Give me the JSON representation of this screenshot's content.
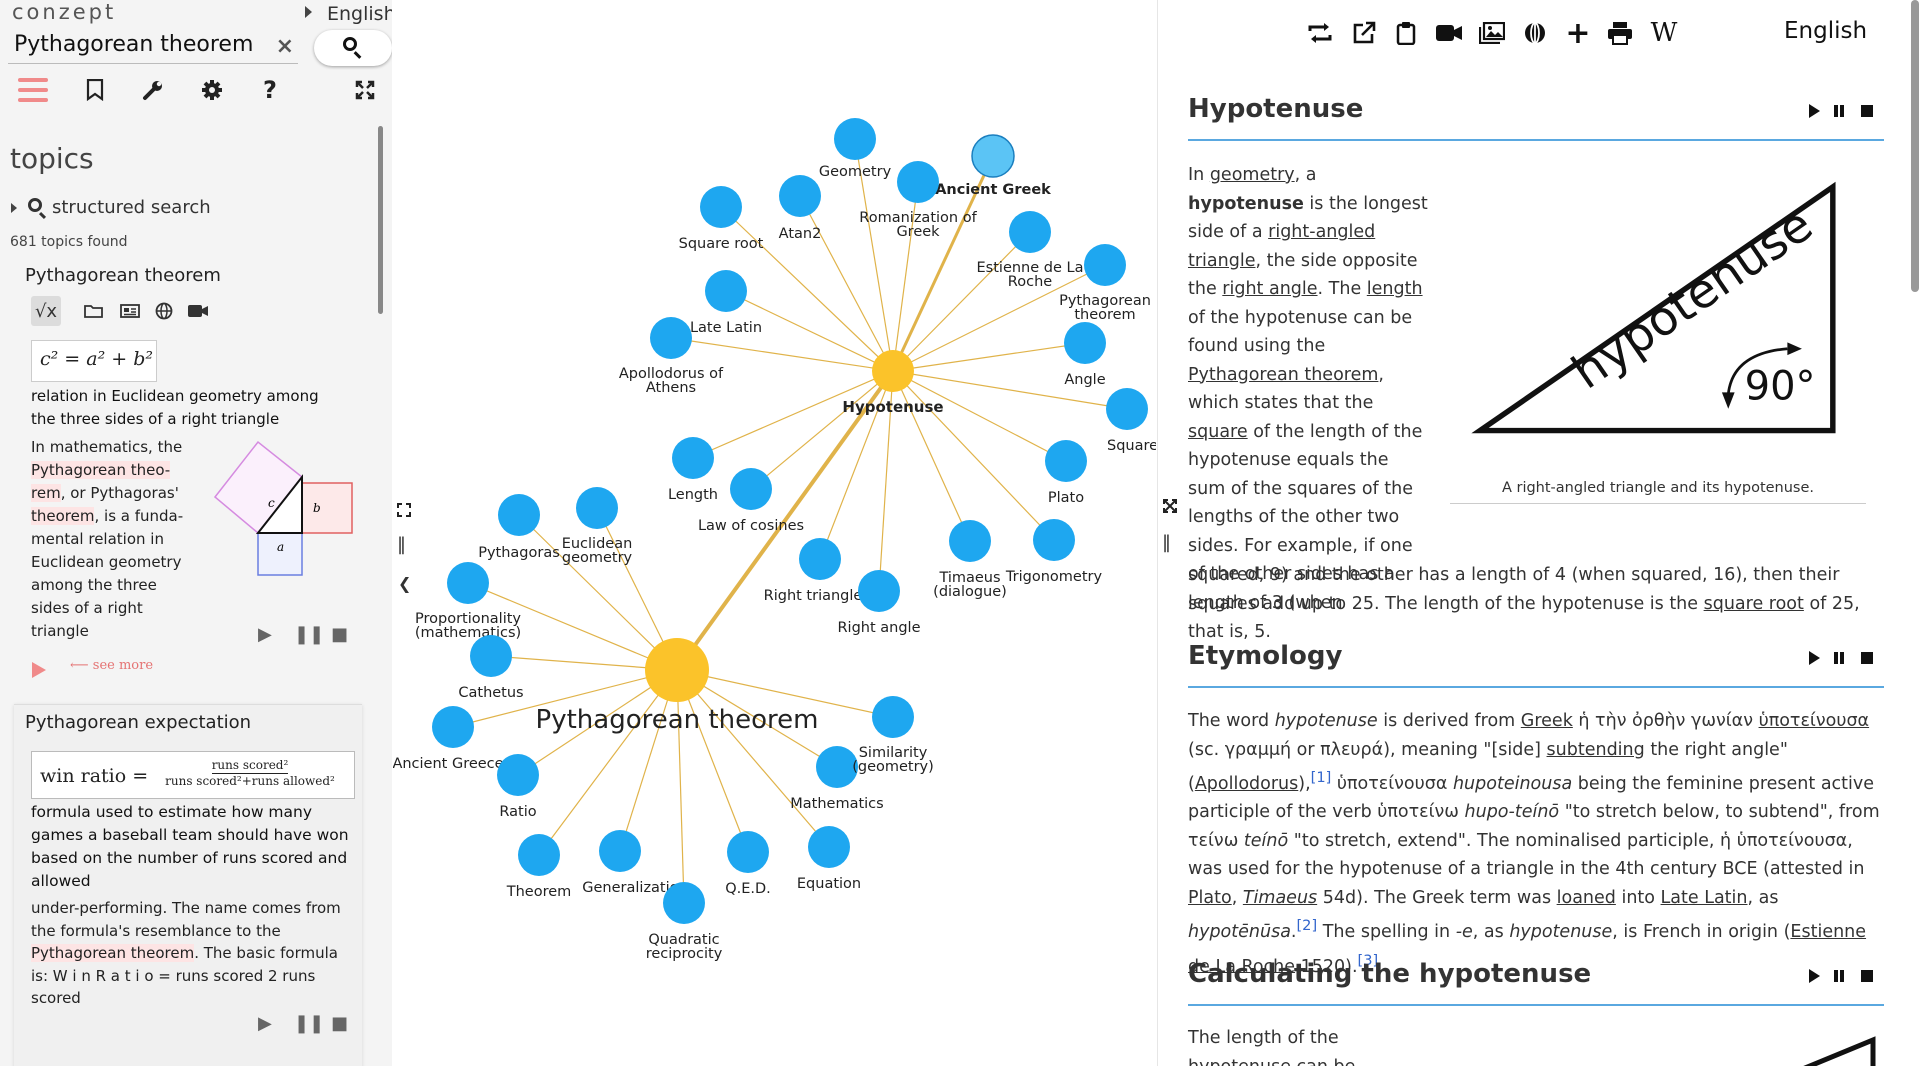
{
  "app": {
    "brand": "conzept",
    "language": "English"
  },
  "search": {
    "value": "Pythagorean theorem",
    "clear_icon": "×"
  },
  "toolbar": {
    "icons": [
      "hamburger-icon",
      "bookmark-icon",
      "wrench-icon",
      "gear-icon",
      "help-icon",
      "fullscreen-icon"
    ]
  },
  "topics": {
    "heading": "topics",
    "structured_search": "structured search",
    "found": "681 topics found"
  },
  "card1": {
    "title": "Pythagorean theorem",
    "formula": "c² = a² + b²",
    "description": "relation in Euclidean geometry among the three sides of a right triangle",
    "summary_pre": "In mathematics, the ",
    "summary_hl1": "Pythagorean theo-rem",
    "summary_mid": ", or Pythagoras' ",
    "summary_hl2": "theorem",
    "summary_post": ", is a funda-mental relation in Euclidean geometry among the three sides of a right triangle",
    "fig_labels": {
      "c": "c",
      "b": "b",
      "a": "a"
    },
    "see_more": "⟵ see more"
  },
  "card2": {
    "title": "Pythagorean expectation",
    "formula_lhs": "win ratio =",
    "formula_num": "runs scored²",
    "formula_den": "runs scored²+runs allowed²",
    "description": "formula used to estimate how many games a baseball team should have won based on the number of runs scored and allowed",
    "summary_pre": "under-performing. The name comes from the formula's resemblance to the ",
    "summary_hl": "Pythagorean theorem",
    "summary_post": ". The basic formula is: W i n   R a t i o = runs scored 2 runs scored"
  },
  "graph": {
    "center_label": "Pythagorean theorem",
    "hub_label": "Hypotenuse",
    "nodes_hub": [
      "Geometry",
      "Ancient Greek",
      "Square root",
      "Atan2",
      "Romanization of Greek",
      "Estienne de La Roche",
      "Pythagorean theorem",
      "Late Latin",
      "Apollodorus of Athens",
      "Angle",
      "Square (algebra)",
      "Plato",
      "Length",
      "Law of cosines",
      "Right triangle",
      "Right angle",
      "Timaeus (dialogue)",
      "Trigonometry"
    ],
    "nodes_center": [
      "Pythagoras",
      "Euclidean geometry",
      "Proportionality (mathematics)",
      "Cathetus",
      "Ancient Greece",
      "Ratio",
      "Theorem",
      "Generalization",
      "Quadratic reciprocity",
      "Q.E.D.",
      "Equation",
      "Mathematics",
      "Similarity (geometry)"
    ],
    "hub_color": "#fbc32a",
    "node_color": "#1ea7f0",
    "edge_color": "#e0b34a"
  },
  "right": {
    "toolbar_icons": [
      "exchange-icon",
      "external-link-icon",
      "clipboard-icon",
      "video-icon",
      "images-icon",
      "globe-icon",
      "plus-icon",
      "print-icon",
      "wikipedia-icon"
    ],
    "language": "English",
    "sections": [
      {
        "title": "Hypotenuse"
      },
      {
        "title": "Etymology"
      },
      {
        "title": "Calculating the hypotenuse"
      }
    ],
    "figure_caption": "A right-angled triangle and its hypotenuse.",
    "figure_word": "hypotenuse",
    "figure_angle": "90°",
    "calc_text": "The length of the hypotenuse can be"
  }
}
